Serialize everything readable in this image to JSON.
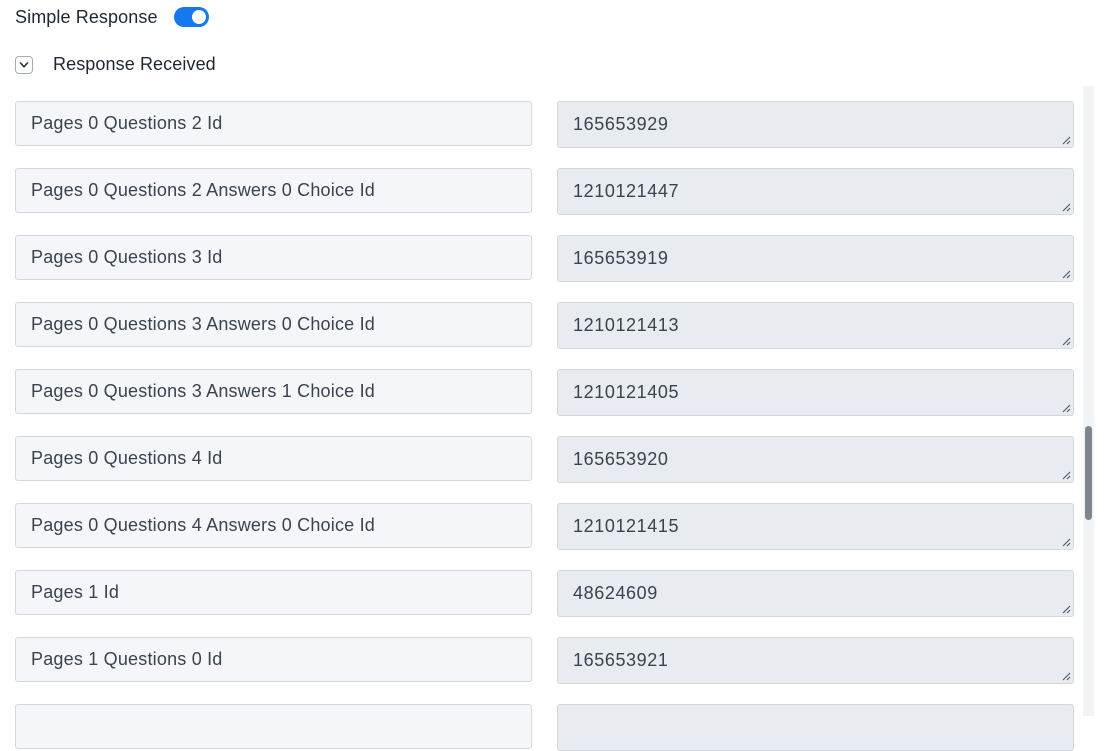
{
  "toggle": {
    "label": "Simple Response",
    "on": true,
    "accent_color": "#1677ee"
  },
  "section": {
    "label": "Response Received",
    "icon": "chevron-down-icon",
    "expanded": true
  },
  "rows": [
    {
      "key": "Pages 0 Questions 2 Id",
      "value": "165653929"
    },
    {
      "key": "Pages 0 Questions 2 Answers 0 Choice Id",
      "value": "1210121447"
    },
    {
      "key": "Pages 0 Questions 3 Id",
      "value": "165653919"
    },
    {
      "key": "Pages 0 Questions 3 Answers 0 Choice Id",
      "value": "1210121413"
    },
    {
      "key": "Pages 0 Questions 3 Answers 1 Choice Id",
      "value": "1210121405"
    },
    {
      "key": "Pages 0 Questions 4 Id",
      "value": "165653920"
    },
    {
      "key": "Pages 0 Questions 4 Answers 0 Choice Id",
      "value": "1210121415"
    },
    {
      "key": "Pages 1 Id",
      "value": "48624609"
    },
    {
      "key": "Pages 1 Questions 0 Id",
      "value": "165653921"
    },
    {
      "key": "",
      "value": ""
    }
  ]
}
